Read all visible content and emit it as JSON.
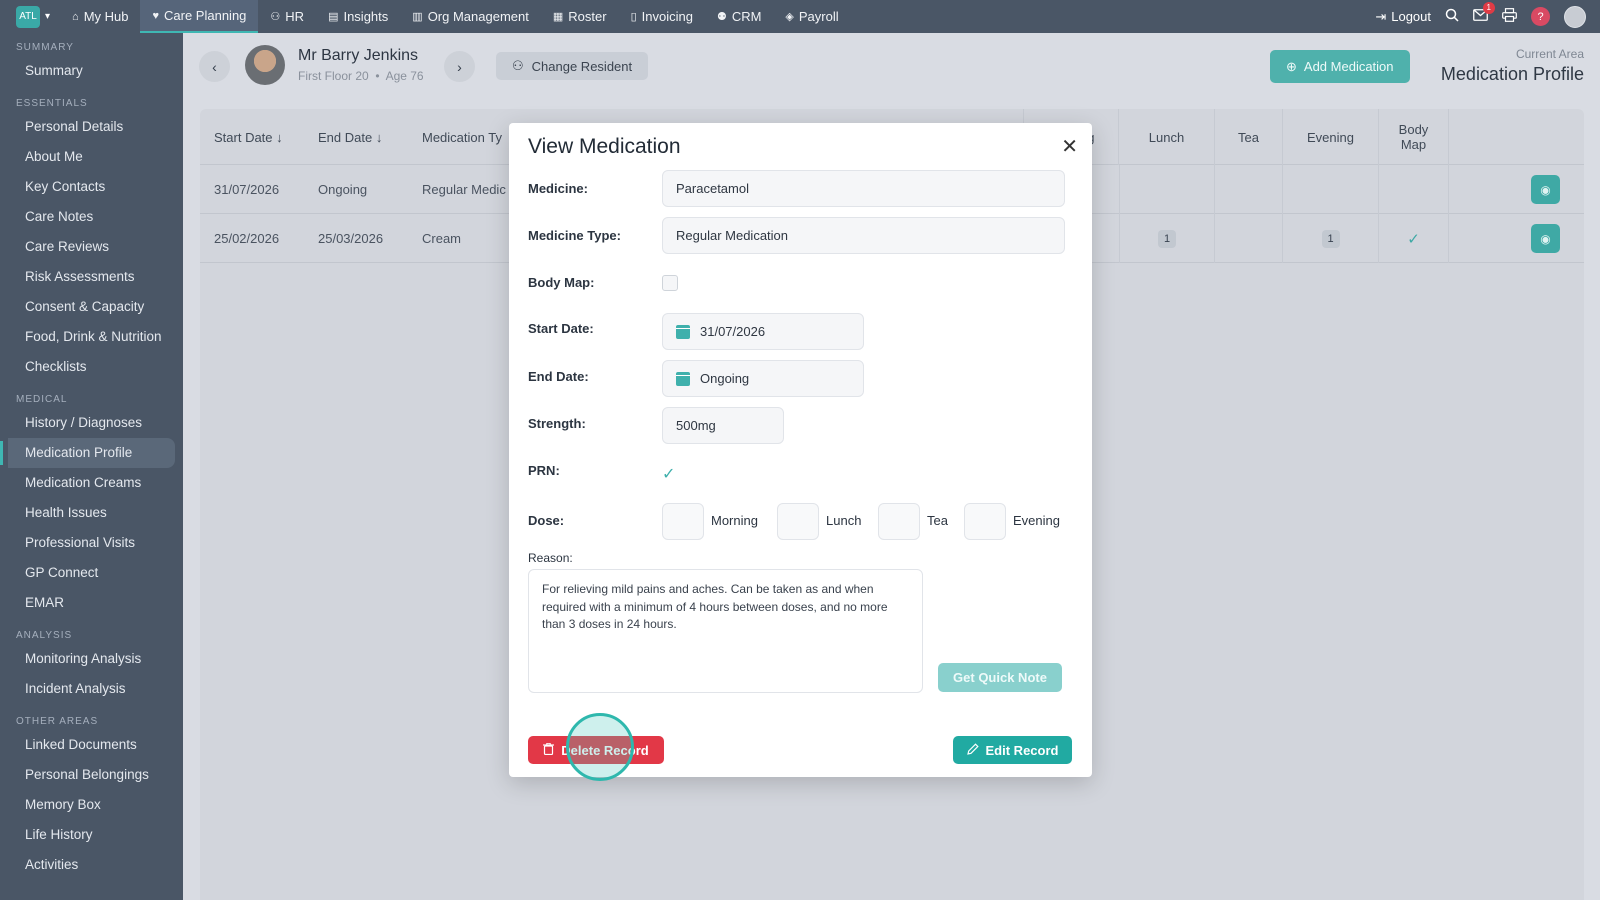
{
  "brand": {
    "logo": "ATL"
  },
  "nav": {
    "items": [
      {
        "label": "My Hub",
        "icon": "home-icon"
      },
      {
        "label": "Care Planning",
        "icon": "heart-icon",
        "active": true
      },
      {
        "label": "HR",
        "icon": "people-icon"
      },
      {
        "label": "Insights",
        "icon": "chart-icon"
      },
      {
        "label": "Org Management",
        "icon": "building-icon"
      },
      {
        "label": "Roster",
        "icon": "calendar-icon"
      },
      {
        "label": "Invoicing",
        "icon": "document-icon"
      },
      {
        "label": "CRM",
        "icon": "contacts-icon"
      },
      {
        "label": "Payroll",
        "icon": "money-icon"
      }
    ],
    "logout": "Logout",
    "mail_count": "1",
    "help": "?"
  },
  "sidebar": {
    "sections": [
      {
        "title": "SUMMARY",
        "items": [
          "Summary"
        ]
      },
      {
        "title": "ESSENTIALS",
        "items": [
          "Personal Details",
          "About Me",
          "Key Contacts",
          "Care Notes",
          "Care Reviews",
          "Risk Assessments",
          "Consent & Capacity",
          "Food, Drink & Nutrition",
          "Checklists"
        ]
      },
      {
        "title": "MEDICAL",
        "items": [
          "History / Diagnoses",
          "Medication Profile",
          "Medication Creams",
          "Health Issues",
          "Professional Visits",
          "GP Connect",
          "EMAR"
        ]
      },
      {
        "title": "ANALYSIS",
        "items": [
          "Monitoring Analysis",
          "Incident Analysis"
        ]
      },
      {
        "title": "OTHER AREAS",
        "items": [
          "Linked Documents",
          "Personal Belongings",
          "Memory Box",
          "Life History",
          "Activities"
        ]
      }
    ],
    "active": "Medication Profile"
  },
  "header": {
    "resident_name": "Mr Barry Jenkins",
    "resident_location": "First Floor 20",
    "resident_age": "Age 76",
    "change_resident": "Change Resident",
    "add_medication": "Add Medication",
    "current_area_label": "Current Area",
    "current_area": "Medication Profile"
  },
  "table": {
    "headers": {
      "start_date": "Start Date",
      "end_date": "End Date",
      "medication_type": "Medication Ty",
      "morning": "Morning",
      "lunch": "Lunch",
      "tea": "Tea",
      "evening": "Evening",
      "body_map_1": "Body",
      "body_map_2": "Map"
    },
    "rows": [
      {
        "start": "31/07/2026",
        "end": "Ongoing",
        "type": "Regular Medic",
        "morning": "",
        "lunch": "",
        "tea": "",
        "evening": "",
        "body_map": false
      },
      {
        "start": "25/02/2026",
        "end": "25/03/2026",
        "type": "Cream",
        "morning": "",
        "lunch": "1",
        "tea": "",
        "evening": "1",
        "body_map": true
      }
    ]
  },
  "modal": {
    "title": "View Medication",
    "labels": {
      "medicine": "Medicine:",
      "medicine_type": "Medicine Type:",
      "body_map": "Body Map:",
      "start_date": "Start Date:",
      "end_date": "End Date:",
      "strength": "Strength:",
      "prn": "PRN:",
      "dose": "Dose:",
      "reason": "Reason:"
    },
    "values": {
      "medicine": "Paracetamol",
      "medicine_type": "Regular Medication",
      "body_map": false,
      "start_date": "31/07/2026",
      "end_date": "Ongoing",
      "strength": "500mg",
      "prn": true,
      "reason": "For relieving mild pains and aches. Can be taken as and when required with a minimum of 4 hours between doses, and no more than 3 doses in 24 hours."
    },
    "dose_labels": {
      "morning": "Morning",
      "lunch": "Lunch",
      "tea": "Tea",
      "evening": "Evening"
    },
    "buttons": {
      "quick_note": "Get Quick Note",
      "delete": "Delete Record",
      "edit": "Edit Record"
    }
  },
  "colors": {
    "accent": "#3fb0ac",
    "danger": "#e23847",
    "nav_bg": "#4a5666"
  }
}
